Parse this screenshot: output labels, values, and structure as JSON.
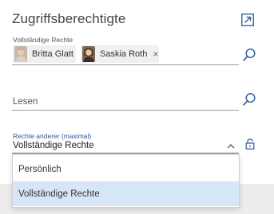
{
  "panel": {
    "title": "Zugriffsberechtigte",
    "icons": {
      "expand": "expand-arrow-icon",
      "search": "search-icon",
      "lock": "lock-icon",
      "chevron": "chevron-up-icon"
    }
  },
  "full_rights": {
    "label": "Vollständige Rechte",
    "people": [
      {
        "name": "Britta Glatt",
        "removable": false
      },
      {
        "name": "Saskia Roth",
        "removable": true,
        "remove_glyph": "×"
      }
    ]
  },
  "read": {
    "placeholder": "Lesen"
  },
  "others_rights": {
    "label": "Rechte anderer (maximal)",
    "value": "Vollständige Rechte",
    "options": [
      {
        "label": "Persönlich",
        "selected": false
      },
      {
        "label": "Vollständige Rechte",
        "selected": true
      }
    ]
  },
  "colors": {
    "accent": "#2b579a",
    "selected": "#d6e6f7",
    "underline": "#9a9a9a",
    "strip": "#ececec"
  }
}
